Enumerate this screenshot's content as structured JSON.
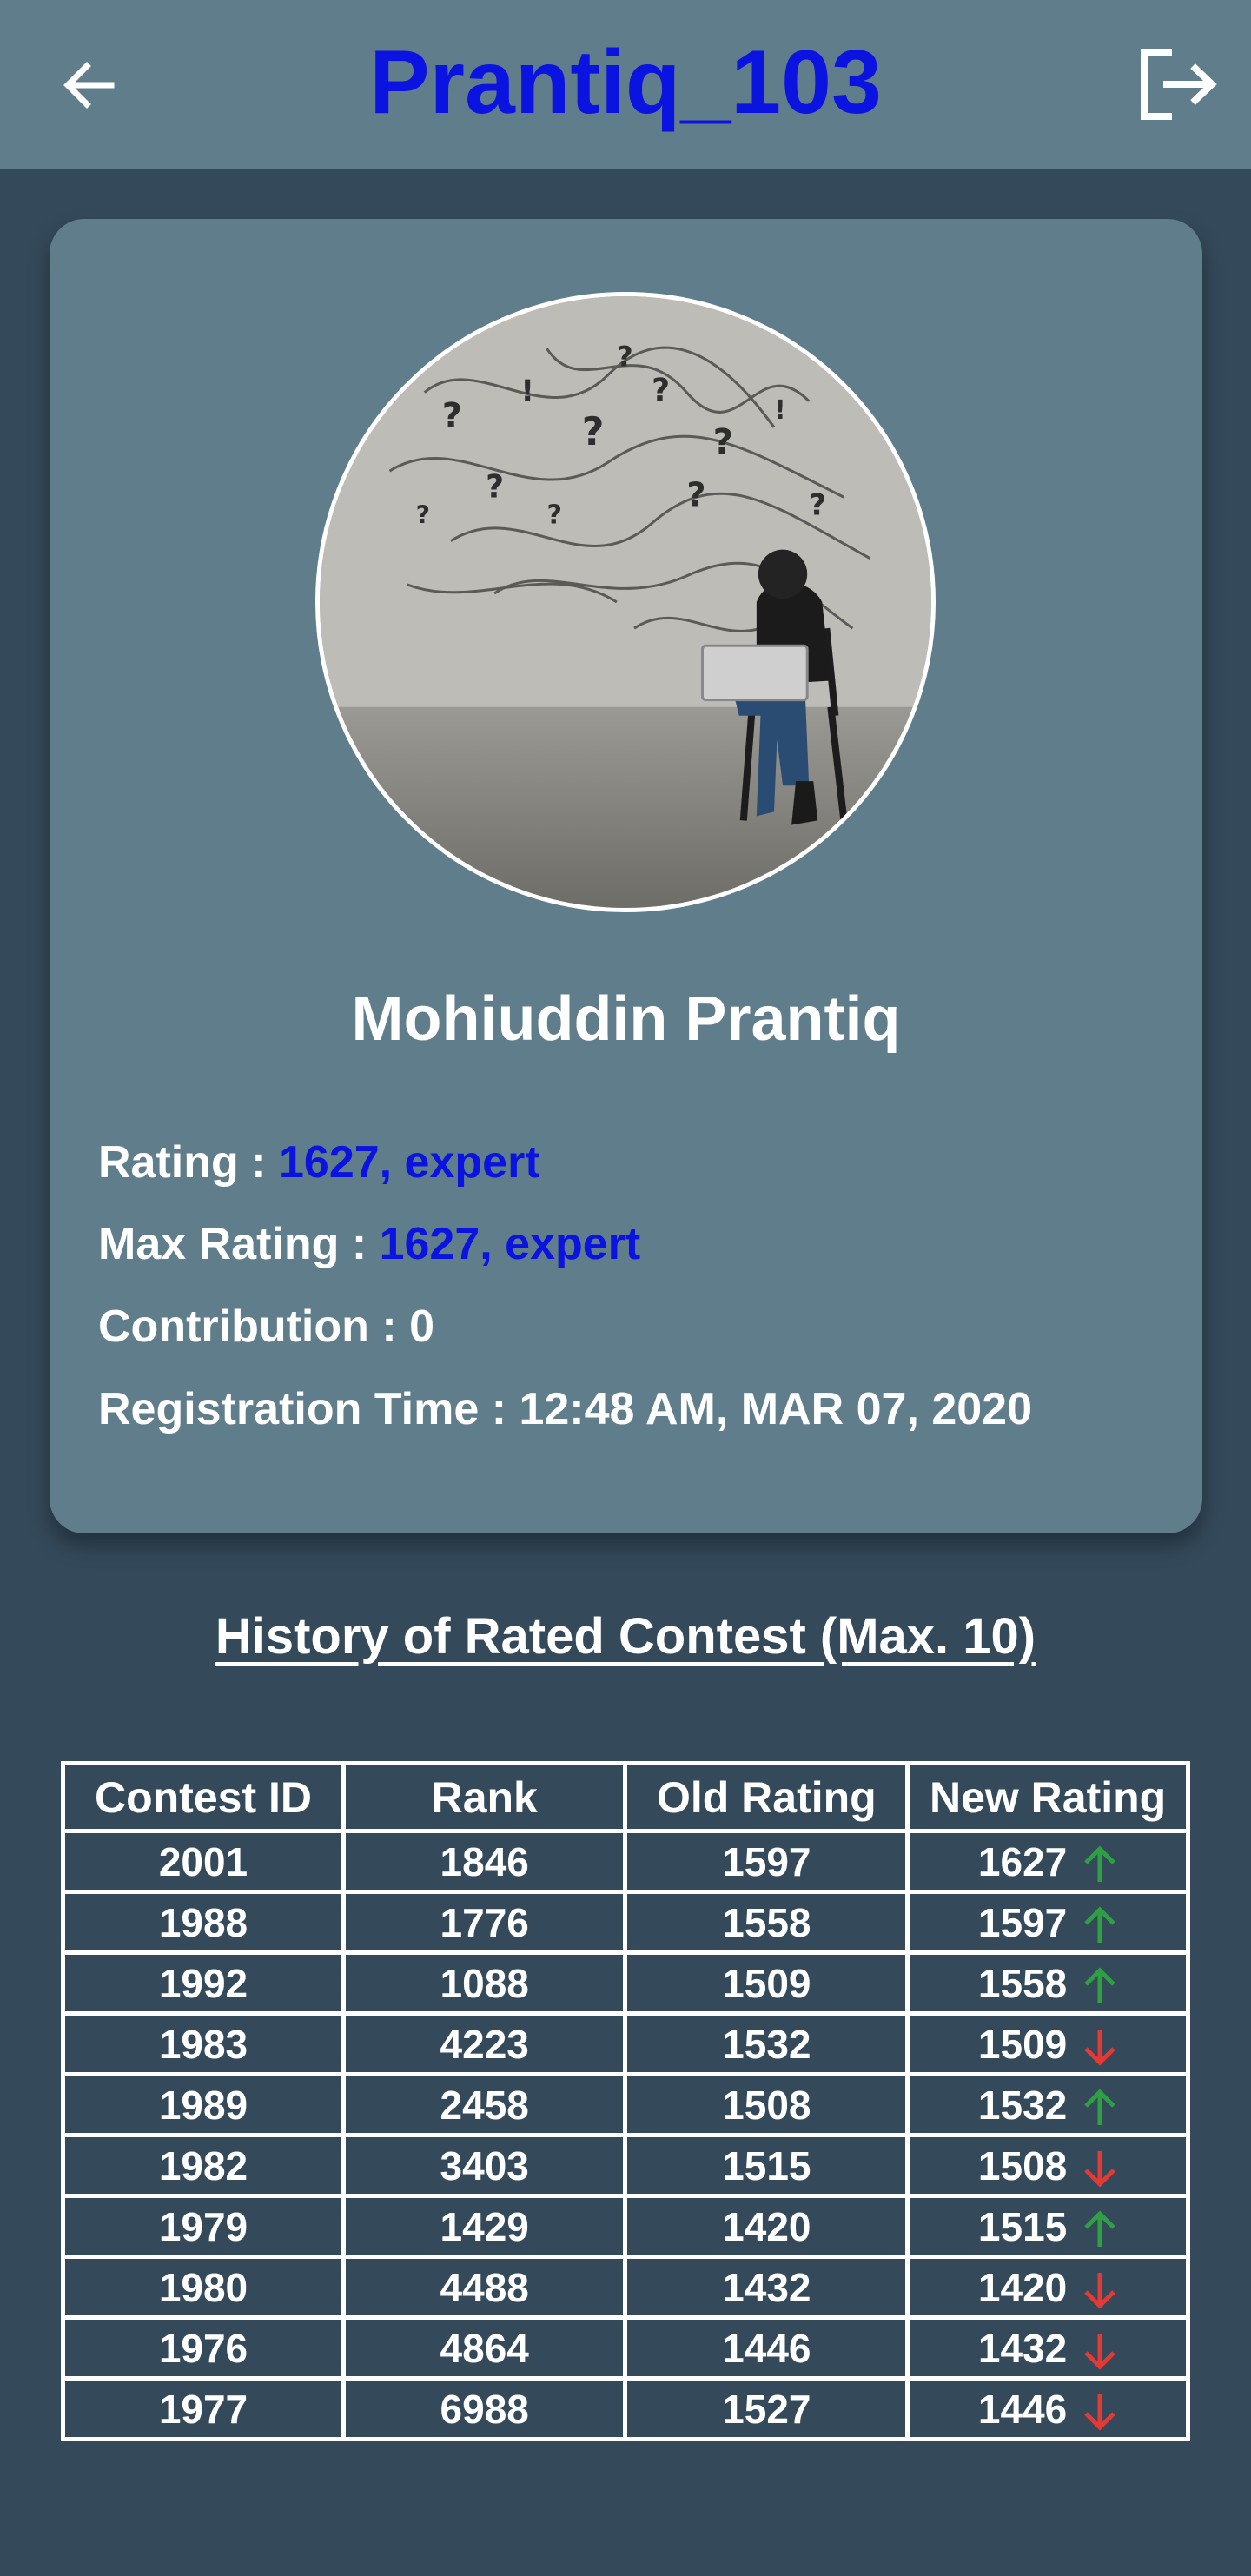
{
  "header": {
    "title": "Prantiq_103",
    "back_icon": "arrow-left-icon",
    "logout_icon": "logout-icon",
    "title_color": "#0a13e0",
    "bar_color": "#607d8b"
  },
  "profile": {
    "full_name": "Mohiuddin Prantiq",
    "avatar": "person-with-laptop-and-question-marks",
    "rating_label": "Rating : ",
    "rating_value": "1627, expert",
    "max_rating_label": "Max Rating : ",
    "max_rating_value": "1627, expert",
    "contribution_label": "Contribution : ",
    "contribution_value": "0",
    "registration_label": "Registration Time : ",
    "registration_value": "12:48 AM, MAR 07, 2020",
    "highlight_color": "#0a13e0"
  },
  "history": {
    "title": "History of Rated Contest (Max. 10)",
    "columns": [
      "Contest ID",
      "Rank",
      "Old Rating",
      "New Rating"
    ],
    "up_color": "#2ea043",
    "down_color": "#e53935",
    "rows": [
      {
        "contest_id": "2001",
        "rank": "1846",
        "old_rating": "1597",
        "new_rating": "1627",
        "trend": "up"
      },
      {
        "contest_id": "1988",
        "rank": "1776",
        "old_rating": "1558",
        "new_rating": "1597",
        "trend": "up"
      },
      {
        "contest_id": "1992",
        "rank": "1088",
        "old_rating": "1509",
        "new_rating": "1558",
        "trend": "up"
      },
      {
        "contest_id": "1983",
        "rank": "4223",
        "old_rating": "1532",
        "new_rating": "1509",
        "trend": "down"
      },
      {
        "contest_id": "1989",
        "rank": "2458",
        "old_rating": "1508",
        "new_rating": "1532",
        "trend": "up"
      },
      {
        "contest_id": "1982",
        "rank": "3403",
        "old_rating": "1515",
        "new_rating": "1508",
        "trend": "down"
      },
      {
        "contest_id": "1979",
        "rank": "1429",
        "old_rating": "1420",
        "new_rating": "1515",
        "trend": "up"
      },
      {
        "contest_id": "1980",
        "rank": "4488",
        "old_rating": "1432",
        "new_rating": "1420",
        "trend": "down"
      },
      {
        "contest_id": "1976",
        "rank": "4864",
        "old_rating": "1446",
        "new_rating": "1432",
        "trend": "down"
      },
      {
        "contest_id": "1977",
        "rank": "6988",
        "old_rating": "1527",
        "new_rating": "1446",
        "trend": "down"
      }
    ]
  }
}
